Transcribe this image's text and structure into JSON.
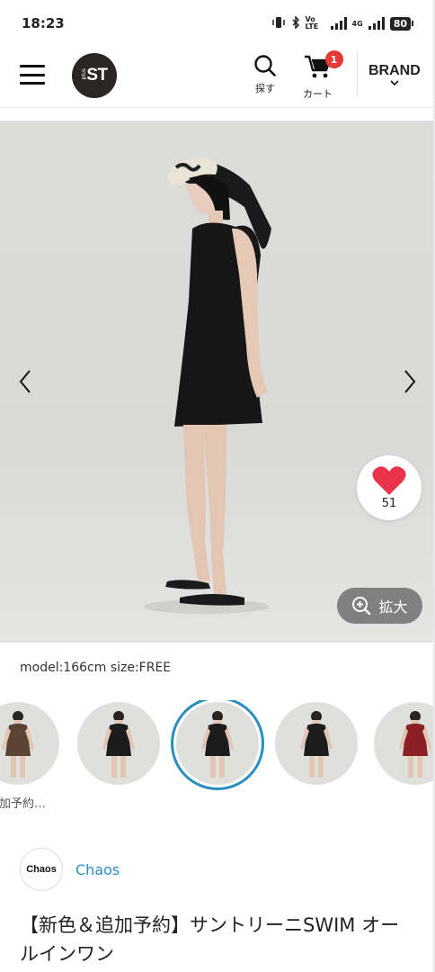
{
  "status_bar": {
    "time": "18:23",
    "network": "Vo LTE",
    "signal2_label": "4G",
    "battery": "80"
  },
  "header": {
    "logo_text": "ST",
    "logo_sub": "plus",
    "search_label": "探す",
    "cart_label": "カート",
    "cart_count": "1",
    "brand_label": "BRAND"
  },
  "hero": {
    "favorite_count": "51",
    "zoom_label": "拡大"
  },
  "model_info": "model:166cm size:FREE",
  "thumbnails": [
    {
      "caption": "追加予約…",
      "dress_color": "#5a4332",
      "active": false
    },
    {
      "caption": "",
      "dress_color": "#1b1b1b",
      "active": false
    },
    {
      "caption": "",
      "dress_color": "#1b1b1b",
      "active": true
    },
    {
      "caption": "",
      "dress_color": "#1b1b1b",
      "active": false
    },
    {
      "caption": "",
      "dress_color": "#8a1f24",
      "active": false
    }
  ],
  "brand": {
    "logo_text": "Chaos",
    "name": "Chaos"
  },
  "product": {
    "title": "【新色＆追加予約】サントリーニSWIM オールインワン"
  },
  "colors": {
    "accent": "#2a8fbf",
    "badge": "#e53935",
    "heart": "#e8334a"
  }
}
